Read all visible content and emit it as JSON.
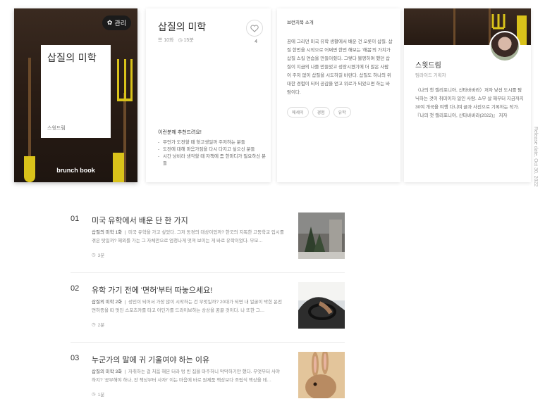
{
  "cover": {
    "manage_label": "관리",
    "title": "삽질의 미학",
    "author": "스윗드림",
    "brand": "brunch book"
  },
  "info": {
    "title": "삽질의 미학",
    "episodes": "10화",
    "minutes": "15분",
    "like_count": "4",
    "recommend_title": "이런분께 추천드려요!",
    "recommend": [
      "무언가 도전할 때 헛고생일까 주저하는 분들",
      "도전에 대해 마음가짐을 다시 다지고 싶으신 분들",
      "시간 낭비라 생각할 때 자책에 좀 한마디가 필요하신 분들"
    ]
  },
  "intro": {
    "heading": "브런치북 소개",
    "body": "꿈에 그리던 미국 유학 생활에서 배운 건 오롯이 삽질. 삽질 한번을 시작으로 어쩌면 한번 해보는 '해봄'의 가치가 삽질 스킬 연습을 만들어줬다. 그렇다 불평하며 했던 삽질이 지금의 나를 만들었고 성장시켰기에 더 많은 사람이 주저 없이 삽질을 시도하길 바란다. 삽질도 하나의 위대한 경험이 되어 공감을 얻고 위로가 되었으면 하는 바람이다.",
    "tags": [
      "에세이",
      "경험",
      "유학"
    ]
  },
  "author": {
    "name": "스윗드림",
    "job": "팀라이드 기획자",
    "bio": "〈나의 첫 캘리포니아, 산타바바라〉저자 낯선 도시를 탐닉하는 것이 취미이자 일인 사람. 스무 살 해부터 지금까지 30여 개국을 여행 다니며 글과 사진으로 기록하는 작가. 『나의 첫 캘리포니아, 산타바바라(2022)』 저자"
  },
  "release_date": "Release date. Oct 30. 2022",
  "chapters": [
    {
      "num": "01",
      "title": "미국 유학에서 배운 단 한 가지",
      "series": "삽질의 미학 1화",
      "desc": "미국 유학을 가고 싶었다. 그저 동경의 대상이었까? 한국의 지독한 고등학교 입시를 겪은 탓일까? 해외를 가는 그 자체만으로 엄청나게 멋져 보이는 게 바로 유학이었다. 부모…",
      "time": "3분"
    },
    {
      "num": "02",
      "title": "유학 가기 전에 '면허'부터 따놓으세요!",
      "series": "삽질의 미학 2화",
      "desc": "성인이 되어서 가장 많이 시작하는 건 무엇일까? 20대가 되면 내 얼굴이 박힌 운전면허증을 따 멋진 스포츠카를 타고 어딘가를 드라이브하는 상상을 꿈꿀 것이다. 나 또한 그…",
      "time": "2분"
    },
    {
      "num": "03",
      "title": "누군가의 말에 귀 기울여야 하는 이유",
      "series": "삽질의 미학 3화",
      "desc": "자취하는 걸 처음 해본 터라 텅 빈 집을 마주하니 막막하기만 했다. 무엇부터 사야 하지? '공부해야 하나, 잔 책상부터 사자!' 이는 마음에 바로 원제품 책상보다 조립식 책상을 데…",
      "time": "1분"
    }
  ]
}
